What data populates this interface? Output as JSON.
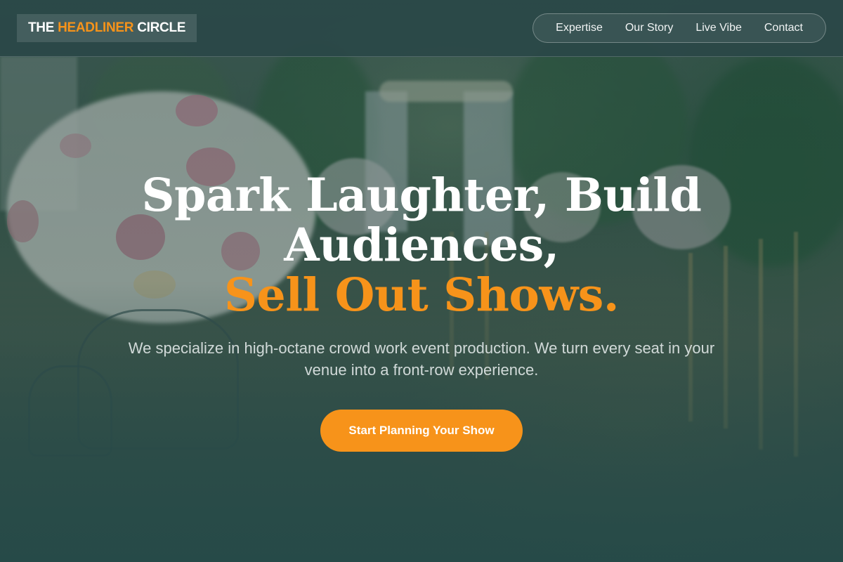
{
  "header": {
    "logo_part1": "THE ",
    "logo_accent": "HEADLINER",
    "logo_part2": " CIRCLE",
    "nav": [
      "Expertise",
      "Our Story",
      "Live Vibe",
      "Contact"
    ]
  },
  "hero": {
    "headline_line1": "Spark Laughter, Build",
    "headline_line2": "Audiences,",
    "headline_line3": "Sell Out Shows.",
    "subtext": "We specialize in high-octane crowd work event production. We turn every seat in your venue into a front-row experience.",
    "cta_label": "Start Planning Your Show"
  },
  "colors": {
    "accent": "#f7931a",
    "header_bg": "#2a4848",
    "text": "#ffffff"
  },
  "background": {
    "description_icon": "wedding-aisle-photo"
  }
}
